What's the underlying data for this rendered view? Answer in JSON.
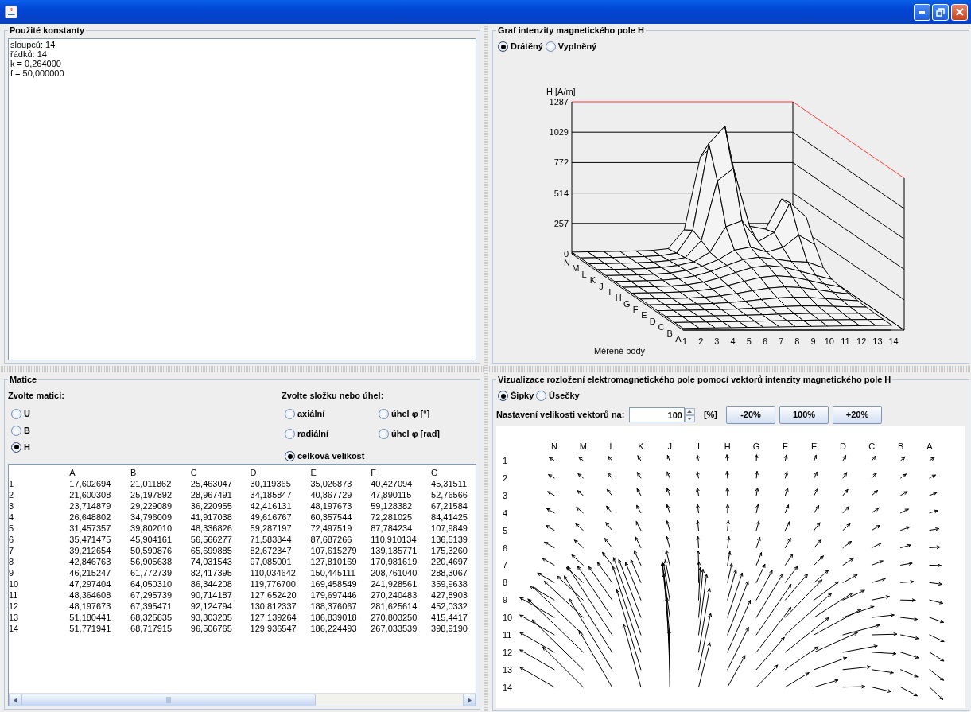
{
  "constants_panel": {
    "title": "Použité konstanty",
    "lines": [
      "sloupců: 14",
      "řádků: 14",
      "k = 0,264000",
      "f = 50,000000"
    ]
  },
  "matrix_panel": {
    "title": "Matice",
    "matrix_prompt": "Zvolte matici:",
    "matrices": [
      {
        "label": "U",
        "selected": false
      },
      {
        "label": "B",
        "selected": false
      },
      {
        "label": "H",
        "selected": true
      }
    ],
    "component_prompt": "Zvolte složku nebo úhel:",
    "components": [
      {
        "label": "axiální",
        "selected": false
      },
      {
        "label": "úhel φ [°]",
        "selected": false
      },
      {
        "label": "radiální",
        "selected": false
      },
      {
        "label": "úhel φ [rad]",
        "selected": false
      },
      {
        "label": "celková velikost",
        "selected": true
      }
    ],
    "table": {
      "columns": [
        "A",
        "B",
        "C",
        "D",
        "E",
        "F",
        "G"
      ],
      "rows": [
        {
          "label": "1",
          "cells": [
            "17,602694",
            "21,011862",
            "25,463047",
            "30,119365",
            "35,026873",
            "40,427094",
            "45,31511"
          ]
        },
        {
          "label": "2",
          "cells": [
            "21,600308",
            "25,197892",
            "28,967491",
            "34,185847",
            "40,867729",
            "47,890115",
            "52,76566"
          ]
        },
        {
          "label": "3",
          "cells": [
            "23,714879",
            "29,229089",
            "36,220955",
            "42,416131",
            "48,197673",
            "59,128382",
            "67,21584"
          ]
        },
        {
          "label": "4",
          "cells": [
            "26,648802",
            "34,796009",
            "41,917038",
            "49,616767",
            "60,357544",
            "72,281025",
            "84,41425"
          ]
        },
        {
          "label": "5",
          "cells": [
            "31,457357",
            "39,802010",
            "48,336826",
            "59,287197",
            "72,497519",
            "87,784234",
            "107,9849"
          ]
        },
        {
          "label": "6",
          "cells": [
            "35,471475",
            "45,904161",
            "56,566277",
            "71,583844",
            "87,687266",
            "110,910134",
            "136,5139"
          ]
        },
        {
          "label": "7",
          "cells": [
            "39,212654",
            "50,590876",
            "65,699885",
            "82,672347",
            "107,615279",
            "139,135771",
            "175,3260"
          ]
        },
        {
          "label": "8",
          "cells": [
            "42,846763",
            "56,905638",
            "74,031543",
            "97,085001",
            "127,810169",
            "170,981619",
            "220,4697"
          ]
        },
        {
          "label": "9",
          "cells": [
            "46,215247",
            "61,772739",
            "82,417395",
            "110,034642",
            "150,445111",
            "208,761040",
            "288,3067"
          ]
        },
        {
          "label": "10",
          "cells": [
            "47,297404",
            "64,050310",
            "86,344208",
            "119,776700",
            "169,458549",
            "241,928561",
            "359,9638"
          ]
        },
        {
          "label": "11",
          "cells": [
            "48,364608",
            "67,295739",
            "90,714187",
            "127,652420",
            "179,697446",
            "270,240483",
            "427,8903"
          ]
        },
        {
          "label": "12",
          "cells": [
            "48,197673",
            "67,395471",
            "92,124794",
            "130,812337",
            "188,376067",
            "281,625614",
            "452,0332"
          ]
        },
        {
          "label": "13",
          "cells": [
            "51,180441",
            "68,325835",
            "93,303205",
            "127,139264",
            "186,839018",
            "270,803250",
            "415,4417"
          ]
        },
        {
          "label": "14",
          "cells": [
            "51,771941",
            "68,717915",
            "96,506765",
            "129,936547",
            "186,224493",
            "267,033539",
            "398,9190"
          ]
        }
      ]
    }
  },
  "graph_panel": {
    "title": "Graf intenzity magnetického pole H",
    "modes": [
      {
        "label": "Drátěný",
        "selected": true
      },
      {
        "label": "Vyplněný",
        "selected": false
      }
    ],
    "y_axis_label": "H [A/m]",
    "y_ticks": [
      "1287",
      "1029",
      "772",
      "514",
      "257",
      "0"
    ],
    "row_labels": [
      "N",
      "M",
      "L",
      "K",
      "J",
      "I",
      "H",
      "G",
      "F",
      "E",
      "D",
      "C",
      "B",
      "A"
    ],
    "column_labels": [
      "1",
      "2",
      "3",
      "4",
      "5",
      "6",
      "7",
      "8",
      "9",
      "10",
      "11",
      "12",
      "13",
      "14"
    ],
    "x_axis_label": "Měřené body"
  },
  "vector_panel": {
    "title": "Vizualizace rozložení elektromagnetického pole pomocí vektorů intenzity magnetického pole H",
    "styles": [
      {
        "label": "Šipky",
        "selected": true
      },
      {
        "label": "Úsečky",
        "selected": false
      }
    ],
    "size_label": "Nastavení velikosti vektorů na:",
    "size_value": "100",
    "unit": "[%]",
    "buttons": [
      "-20%",
      "100%",
      "+20%"
    ],
    "column_labels": [
      "N",
      "M",
      "L",
      "K",
      "J",
      "I",
      "H",
      "G",
      "F",
      "E",
      "D",
      "C",
      "B",
      "A"
    ],
    "row_labels": [
      "1",
      "2",
      "3",
      "4",
      "5",
      "6",
      "7",
      "8",
      "9",
      "10",
      "11",
      "12",
      "13",
      "14"
    ]
  }
}
